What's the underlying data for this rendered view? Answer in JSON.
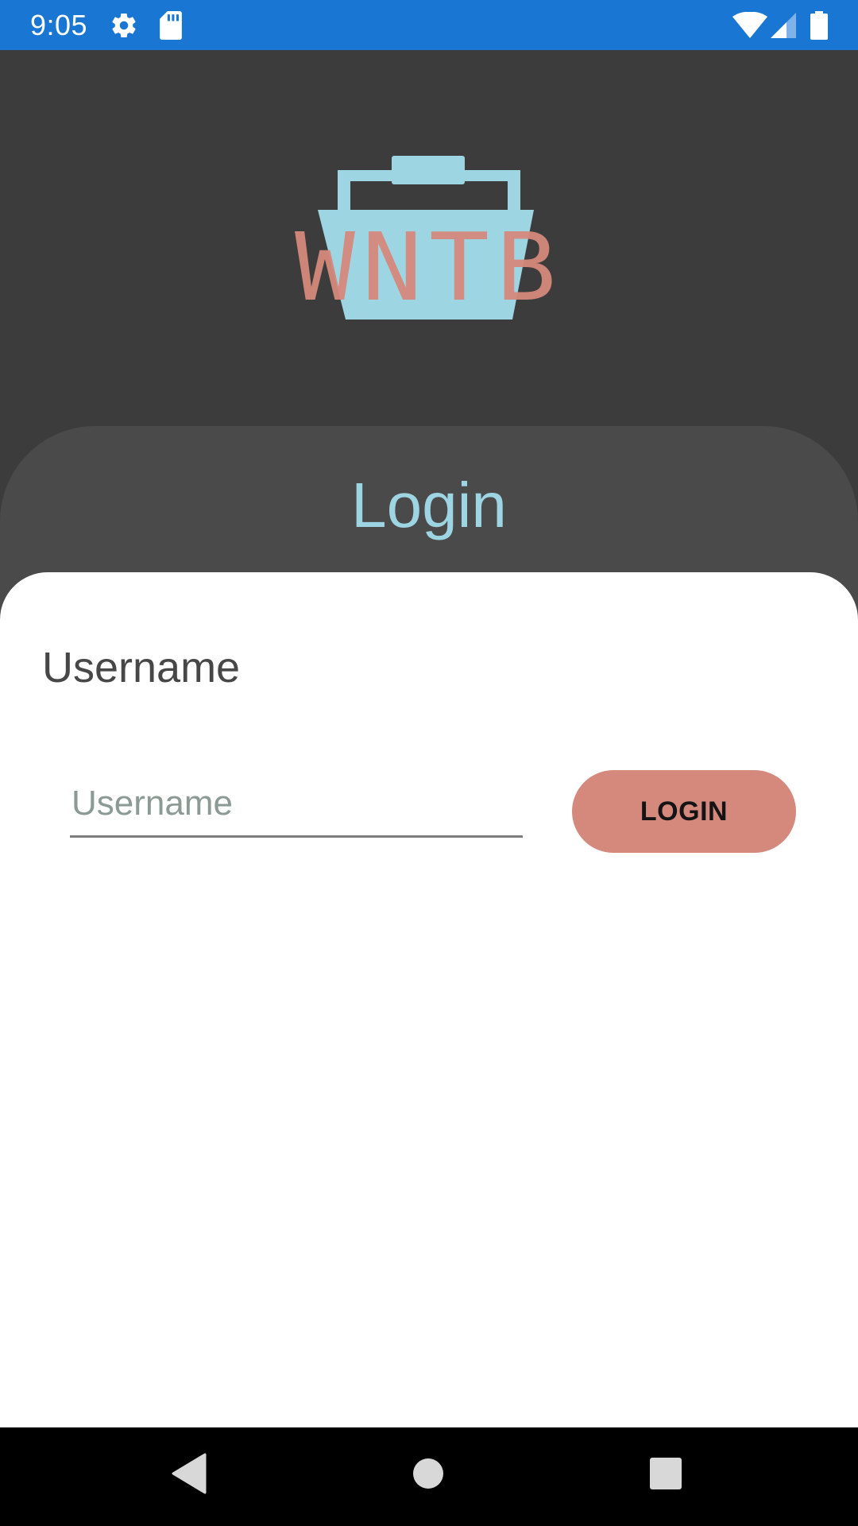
{
  "status_bar": {
    "time": "9:05",
    "icons": [
      "settings-icon",
      "sd-card-icon",
      "wifi-icon",
      "cell-signal-icon",
      "battery-icon"
    ]
  },
  "logo": {
    "wordmark": "WNTB",
    "icon": "basket-logo",
    "colors": {
      "basket": "#9ed5e2",
      "letters": "#d5897c"
    }
  },
  "page": {
    "title": "Login"
  },
  "form": {
    "username_label": "Username",
    "username_placeholder": "Username",
    "username_value": "",
    "login_button_label": "LOGIN"
  },
  "nav_bar": {
    "icons": [
      "back-icon",
      "home-icon",
      "recents-icon"
    ]
  },
  "colors": {
    "status_bar": "#1976d2",
    "background": "#3c3c3d",
    "panel": "#4a4a4b",
    "title": "#9ed5e2",
    "button": "#d5897c",
    "card": "#ffffff"
  }
}
